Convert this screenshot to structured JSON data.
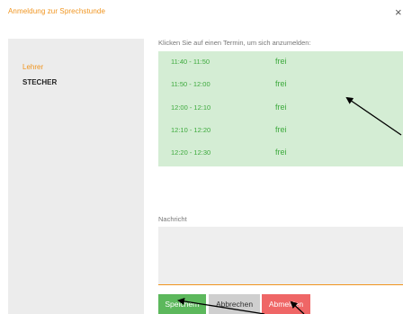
{
  "dialog": {
    "title": "Anmeldung zur Sprechstunde",
    "close_glyph": "×"
  },
  "sidebar": {
    "label": "Lehrer",
    "value": "STECHER"
  },
  "main": {
    "instruction": "Klicken Sie auf einen Termin, um sich anzumelden:",
    "slots": [
      {
        "time": "11:40 - 11:50",
        "status": "frei"
      },
      {
        "time": "11:50 - 12:00",
        "status": "frei"
      },
      {
        "time": "12:00 - 12:10",
        "status": "frei"
      },
      {
        "time": "12:10 - 12:20",
        "status": "frei"
      },
      {
        "time": "12:20 - 12:30",
        "status": "frei"
      }
    ],
    "message_label": "Nachricht",
    "message_value": ""
  },
  "buttons": {
    "save": "Speichern",
    "cancel": "Abbrechen",
    "unsubscribe": "Abmelden"
  },
  "colors": {
    "accent": "#f0941e",
    "slot_bg": "#d4edd4",
    "slot_text": "#3eaa3e",
    "save": "#5cb85c",
    "cancel": "#cfcfcf",
    "unsubscribe": "#ef6666"
  }
}
